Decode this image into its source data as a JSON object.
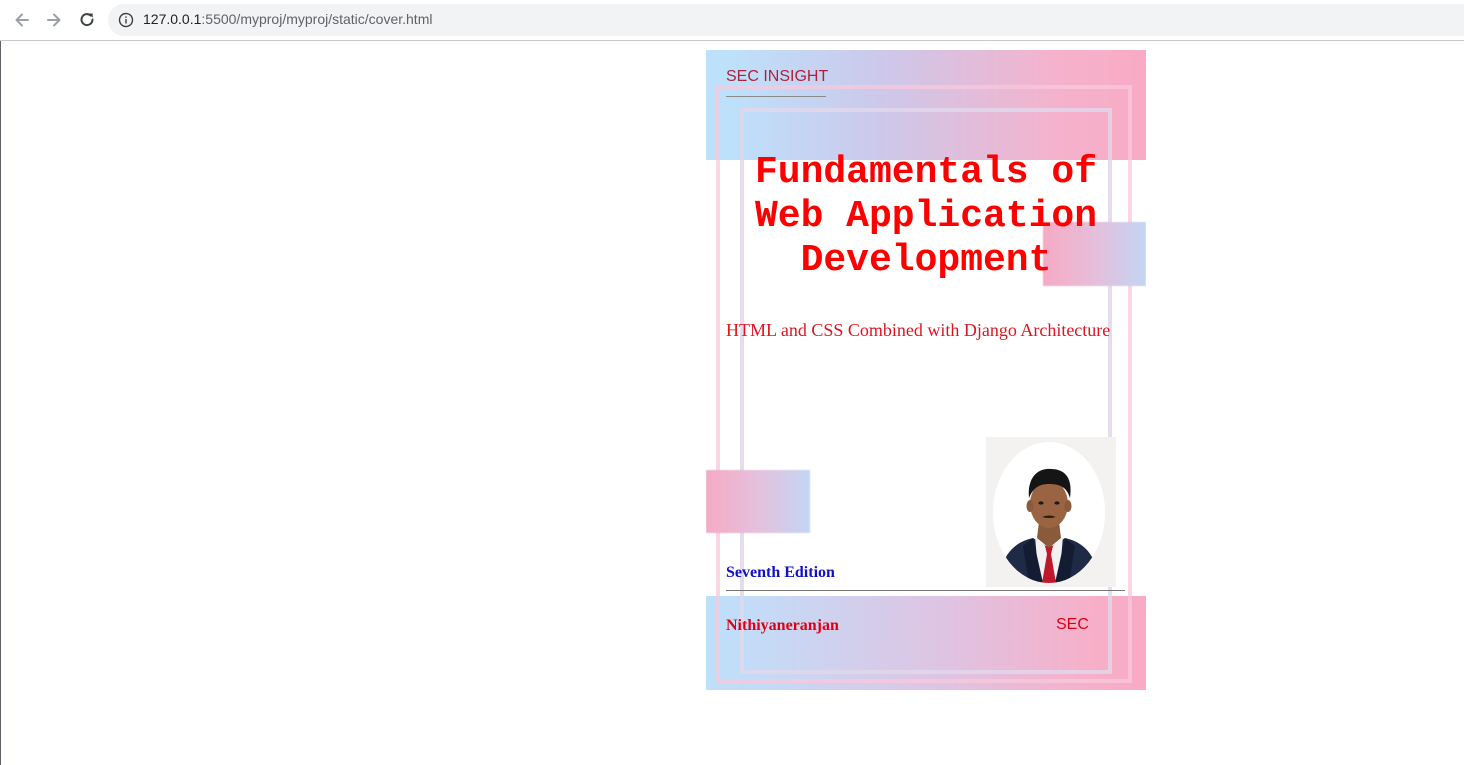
{
  "browser": {
    "url_host": "127.0.0.1",
    "url_rest": ":5500/myproj/myproj/static/cover.html",
    "icons": {
      "back": "arrow-left-icon",
      "forward": "arrow-right-icon",
      "reload": "reload-icon",
      "site_info": "info-icon"
    }
  },
  "cover": {
    "series": "SEC INSIGHT",
    "title": "Fundamentals of Web Application Development",
    "subtitle": "HTML and CSS Combined with Django Architecture",
    "edition": "Seventh Edition",
    "author": "Nithiyaneranjan",
    "publisher": "SEC",
    "colors": {
      "title": "#ff0000",
      "series": "#b0223a",
      "edition": "#1010c8",
      "author": "#e00012",
      "band_blue": "#bde0fb",
      "band_pink": "#f9aac4"
    }
  }
}
